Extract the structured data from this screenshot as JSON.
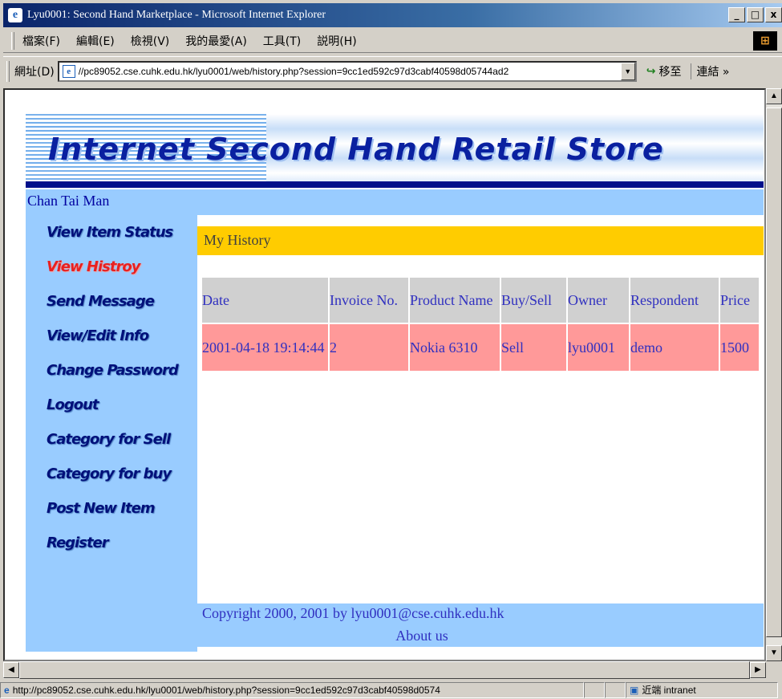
{
  "window": {
    "title": "Lyu0001: Second Hand Marketplace - Microsoft Internet Explorer",
    "btn_min": "_",
    "btn_max": "□",
    "btn_close": "x"
  },
  "menu": {
    "items": [
      "檔案(F)",
      "編輯(E)",
      "檢視(V)",
      "我的最愛(A)",
      "工具(T)",
      "説明(H)"
    ]
  },
  "address": {
    "label": "網址(D)",
    "url": "//pc89052.cse.cuhk.edu.hk/lyu0001/web/history.php?session=9cc1ed592c97d3cabf40598d05744ad2",
    "go_label": "移至",
    "links_label": "連結 »"
  },
  "page": {
    "banner_title": "Internet Second Hand Retail Store",
    "user_name": "Chan Tai Man",
    "nav": [
      {
        "label": "View Item Status",
        "active": false
      },
      {
        "label": "View Histroy",
        "active": true
      },
      {
        "label": "Send Message",
        "active": false
      },
      {
        "label": "View/Edit Info",
        "active": false
      },
      {
        "label": "Change Password",
        "active": false
      },
      {
        "label": "Logout",
        "active": false
      },
      {
        "label": "Category for Sell",
        "active": false
      },
      {
        "label": "Category for buy",
        "active": false
      },
      {
        "label": "Post New Item",
        "active": false
      },
      {
        "label": "Register",
        "active": false
      }
    ],
    "section_title": "My History",
    "table": {
      "headers": [
        "Date",
        "Invoice No.",
        "Product Name",
        "Buy/Sell",
        "Owner",
        "Respondent",
        "Price"
      ],
      "rows": [
        [
          "2001-04-18 19:14:44",
          "2",
          "Nokia 6310",
          "Sell",
          "lyu0001",
          "demo",
          "1500"
        ]
      ]
    },
    "footer_copyright": "Copyright 2000, 2001 by lyu0001@cse.cuhk.edu.hk",
    "footer_about": "About us"
  },
  "status": {
    "url": "http://pc89052.cse.cuhk.edu.hk/lyu0001/web/history.php?session=9cc1ed592c97d3cabf40598d0574",
    "zone": "近端 intranet"
  },
  "colors": {
    "sidebar_bg": "#99ccff",
    "header_bg": "#ffcc00",
    "row_bg": "#ff9999",
    "th_bg": "#d0d0d0",
    "active_nav": "#e82020"
  }
}
